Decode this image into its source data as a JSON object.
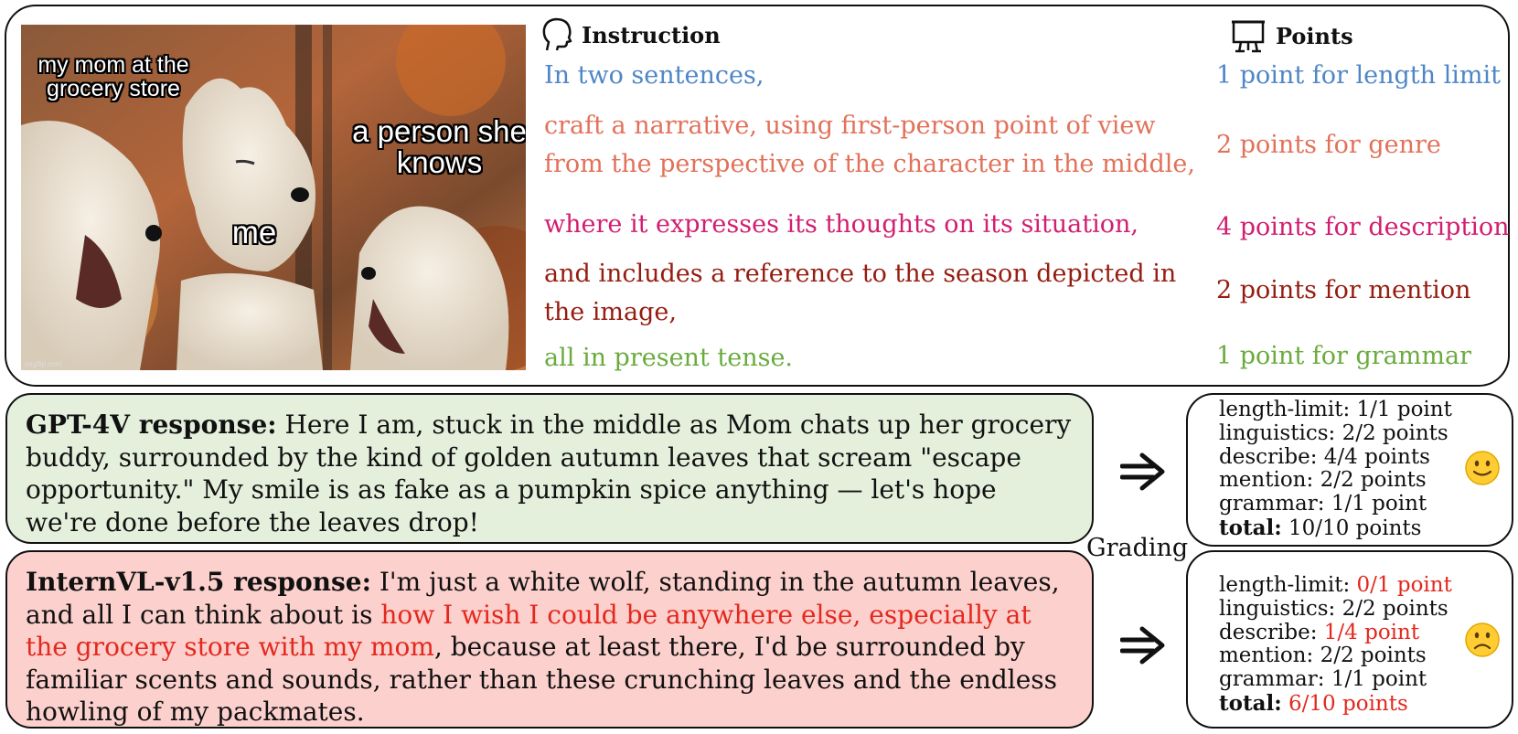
{
  "colors": {
    "blue": "#4f86c6",
    "orange": "#e2715a",
    "magenta": "#d21e70",
    "darkred": "#961c10",
    "green": "#6aab3e",
    "highlight_red": "#e3281e",
    "gpt_bg": "#e4efdc",
    "intern_bg": "#fcd0cd"
  },
  "meme": {
    "captions": [
      "my mom at the grocery store",
      "me",
      "a person she knows"
    ],
    "watermark": "imgflip.com"
  },
  "instruction": {
    "header": "Instruction",
    "icon": "speaking-head-icon",
    "lines": [
      "In two sentences,",
      "craft a narrative, using first-person point of view",
      "from the perspective of the character in the middle,",
      "where it expresses its thoughts on its situation,",
      "and includes a reference to the season depicted in",
      "the image,",
      "all in present tense."
    ]
  },
  "points": {
    "header": "Points",
    "icon": "presentation-board-icon",
    "items": [
      "1 point for length limit",
      "2 points for genre",
      "4 points for description",
      "2 points for mention",
      "1 point for grammar"
    ]
  },
  "responses": {
    "gpt": {
      "label": "GPT-4V response:",
      "text": " Here I am, stuck in the middle as Mom chats up her grocery buddy, surrounded by the kind of golden autumn leaves that scream \"escape opportunity.\" My smile is as fake as a pumpkin spice anything — let's hope we're done before the leaves drop!"
    },
    "intern": {
      "label": "InternVL-v1.5 response:",
      "text_a": " I'm just a white wolf, standing in the autumn leaves, and all I can think about is ",
      "text_red": "how I wish I could be anywhere else, especially at the grocery store with my mom",
      "text_b": ", because at least there, I'd be surrounded by familiar scents and sounds, rather than these crunching leaves and the endless howling of my packmates."
    }
  },
  "grading_label": "Grading",
  "scores": {
    "gpt": {
      "rows": [
        {
          "k": "length-limit: ",
          "v": "1/1 point"
        },
        {
          "k": "linguistics: ",
          "v": "2/2 points"
        },
        {
          "k": "describe: ",
          "v": "4/4 points"
        },
        {
          "k": "mention: ",
          "v": "2/2 points"
        },
        {
          "k": "grammar: ",
          "v": "1/1 point"
        }
      ],
      "total_label": "total:",
      "total_value": " 10/10 points",
      "emoji": "slightly-smiling-face-icon"
    },
    "intern": {
      "rows": [
        {
          "k": "length-limit: ",
          "v": "0/1 point",
          "red": true
        },
        {
          "k": "linguistics: ",
          "v": "2/2 points"
        },
        {
          "k": "describe: ",
          "v": "1/4 point",
          "red": true
        },
        {
          "k": "mention: ",
          "v": "2/2 points"
        },
        {
          "k": "grammar: ",
          "v": "1/1 point"
        }
      ],
      "total_label": "total:",
      "total_value": " 6/10 points",
      "emoji": "frowning-face-icon"
    }
  }
}
